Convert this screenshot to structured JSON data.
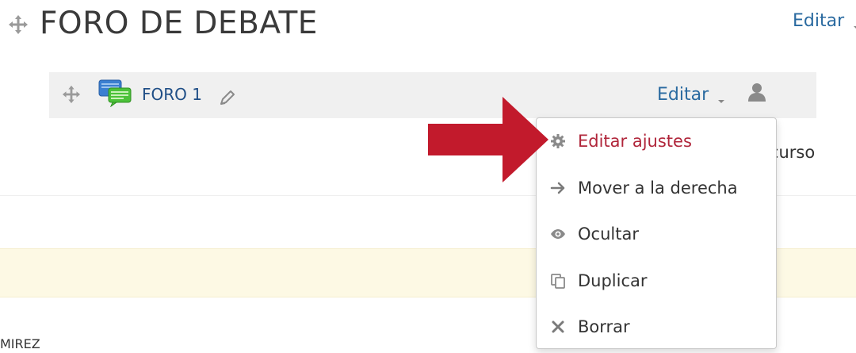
{
  "section": {
    "title": "FORO DE DEBATE",
    "edit_label": "Editar",
    "move_icon": "move-icon",
    "caret_icon": "caret-down-icon"
  },
  "activity": {
    "name": "FORO 1",
    "edit_label": "Editar",
    "icons": [
      "move-icon",
      "forum-icon",
      "pencil-icon",
      "caret-down-icon",
      "user-icon"
    ]
  },
  "menu": {
    "items": [
      {
        "label": "Editar ajustes",
        "icon": "gear-icon",
        "active": true
      },
      {
        "label": "Mover a la derecha",
        "icon": "arrow-right-icon",
        "active": false
      },
      {
        "label": "Ocultar",
        "icon": "eye-icon",
        "active": false
      },
      {
        "label": "Duplicar",
        "icon": "duplicate-icon",
        "active": false
      },
      {
        "label": "Borrar",
        "icon": "delete-x-icon",
        "active": false
      }
    ]
  },
  "background": {
    "partial_recurso": "ecurso",
    "partial_name": "MIREZ"
  },
  "annotation": {
    "arrow_icon": "red-arrow-icon"
  },
  "colors": {
    "link": "#2a6aa0",
    "active_item": "#b0253a",
    "annotation_arrow": "#c21a2c",
    "row_background": "#f0f0f0",
    "highlight_band": "#fdf9e4"
  }
}
